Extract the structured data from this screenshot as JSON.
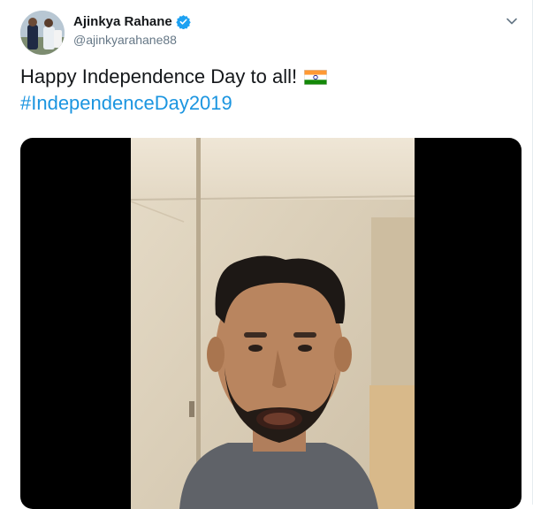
{
  "author": {
    "display_name": "Ajinkya Rahane",
    "handle": "@ajinkyarahane88",
    "verified": true,
    "avatar": "profile-photo"
  },
  "tweet": {
    "text": "Happy Independence Day to all!",
    "emoji": "indian-flag",
    "hashtag": "#IndependenceDay2019"
  },
  "media": {
    "type": "video",
    "subject": "man speaking to camera"
  },
  "icons": {
    "verified": "verified-badge-icon",
    "menu": "chevron-down-icon"
  },
  "colors": {
    "link": "#1b95e0",
    "verified": "#1da1f2",
    "secondary_text": "#657786",
    "primary_text": "#14171a"
  }
}
